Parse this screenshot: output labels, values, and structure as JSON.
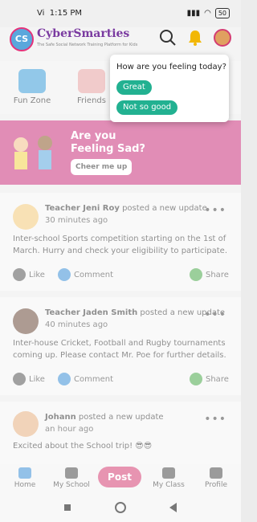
{
  "status": {
    "carrier": "Vi",
    "time": "1:15 PM",
    "battery": "50"
  },
  "header": {
    "logo_text": "CyberSmarties",
    "logo_badge": "CS",
    "logo_tagline": "The Safe Social Network Training Platform for Kids"
  },
  "quick": [
    {
      "label": "Fun Zone"
    },
    {
      "label": "Friends"
    }
  ],
  "banner": {
    "title": "Are you Feeling Sad?",
    "button": "Cheer me up"
  },
  "posts": [
    {
      "author": "Teacher Jeni Roy",
      "action": " posted a new update",
      "time": "30 minutes ago",
      "text": "Inter-school Sports competition starting on the 1st of March. Hurry and check your eligibility to participate."
    },
    {
      "author": "Teacher Jaden Smith",
      "action": " posted a new update",
      "time": "40 minutes ago",
      "text": "Inter-house Cricket, Football and Rugby tournaments coming up. Please contact Mr. Poe for further details."
    },
    {
      "author": "Johann",
      "action": " posted a new update",
      "time": "an hour ago",
      "text": "Excited about the School trip! 😎😎"
    }
  ],
  "post_actions": {
    "like": "Like",
    "comment": "Comment",
    "share": "Share"
  },
  "nav": {
    "home": "Home",
    "school": "My School",
    "post": "Post",
    "class": "My Class",
    "profile": "Profile"
  },
  "popup": {
    "question": "How are you feeling today?",
    "great": "Great",
    "not_good": "Not so good"
  },
  "colors": {
    "accent": "#c9317b",
    "teal": "#22b191"
  }
}
